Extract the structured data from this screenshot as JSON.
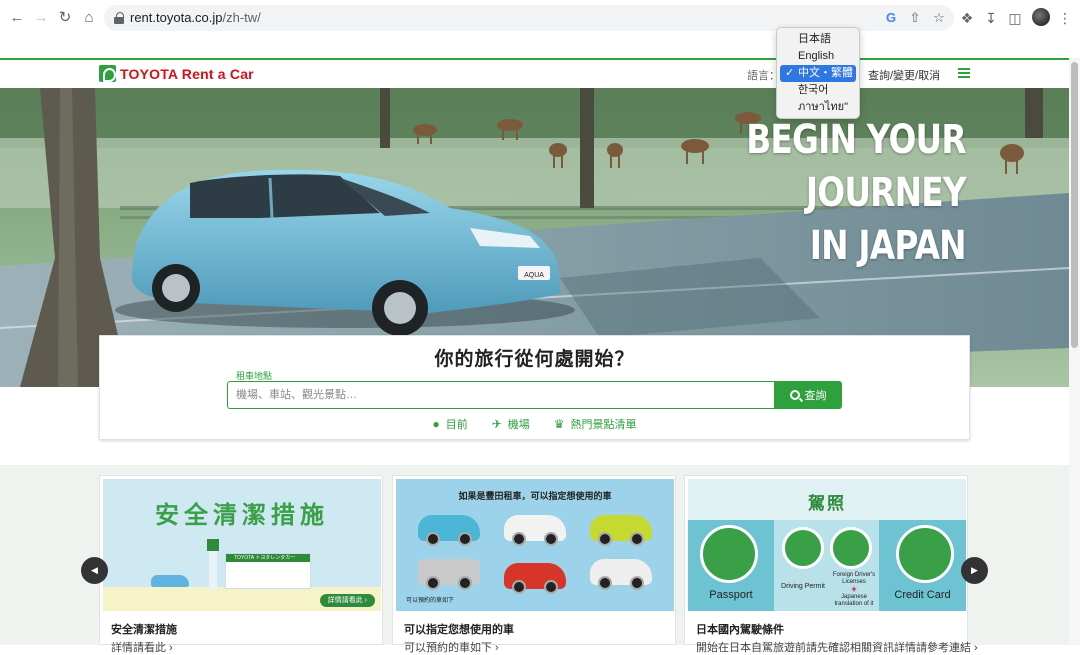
{
  "browser": {
    "url_host": "rent.toyota.co.jp",
    "url_path": "/zh-tw/"
  },
  "header": {
    "logo_text": "TOYOTA Rent a Car",
    "language_label": "語言：",
    "reservation_link": "查詢/變更/取消"
  },
  "language_dropdown": {
    "options": [
      "日本語",
      "English",
      "中文・繁體",
      "한국어",
      "ภาษาไทย\""
    ],
    "selected": "中文・繁體"
  },
  "hero": {
    "line1": "BEGIN YOUR",
    "line2": "JOURNEY",
    "line3": "IN JAPAN",
    "car_plate": "AQUA"
  },
  "search": {
    "title": "你的旅行從何處開始？",
    "field_label": "租車地點",
    "placeholder": "機場、車站、觀光景點…",
    "button_label": "查詢",
    "quick_links": [
      {
        "label": "目前",
        "icon": "map-pin-icon"
      },
      {
        "label": "機場",
        "icon": "airplane-icon"
      },
      {
        "label": "熱門景點清單",
        "icon": "crown-icon"
      }
    ]
  },
  "banners": [
    {
      "image_title": "安全清潔措施",
      "shop_sign": "TOYOTA トヨタレンタカー",
      "image_button": "詳情請看此 ›",
      "title": "安全清潔措施",
      "subtitle": "詳情請看此 ›"
    },
    {
      "image_heading": "如果是豐田租車，可以指定想使用的車",
      "image_footer": "可以預約的車如下",
      "title": "可以指定您想使用的車",
      "subtitle": "可以預約的車如下 ›"
    },
    {
      "image_heading": "駕照",
      "passport_label": "Passport",
      "permit_label": "Driving Permit",
      "foreign_label": "Foreign Driver's Licenses",
      "plus": "+",
      "translation_label": "Japanese translation of it",
      "card_label": "Credit Card",
      "title": "日本國內駕駛條件",
      "subtitle": "開始在日本自駕旅遊前請先確認相關資訊詳情請參考連結 ›"
    }
  ],
  "colors": {
    "brand_green": "#2ea03c",
    "toyota_red": "#d4101a",
    "dropdown_selected": "#2f78e4"
  }
}
